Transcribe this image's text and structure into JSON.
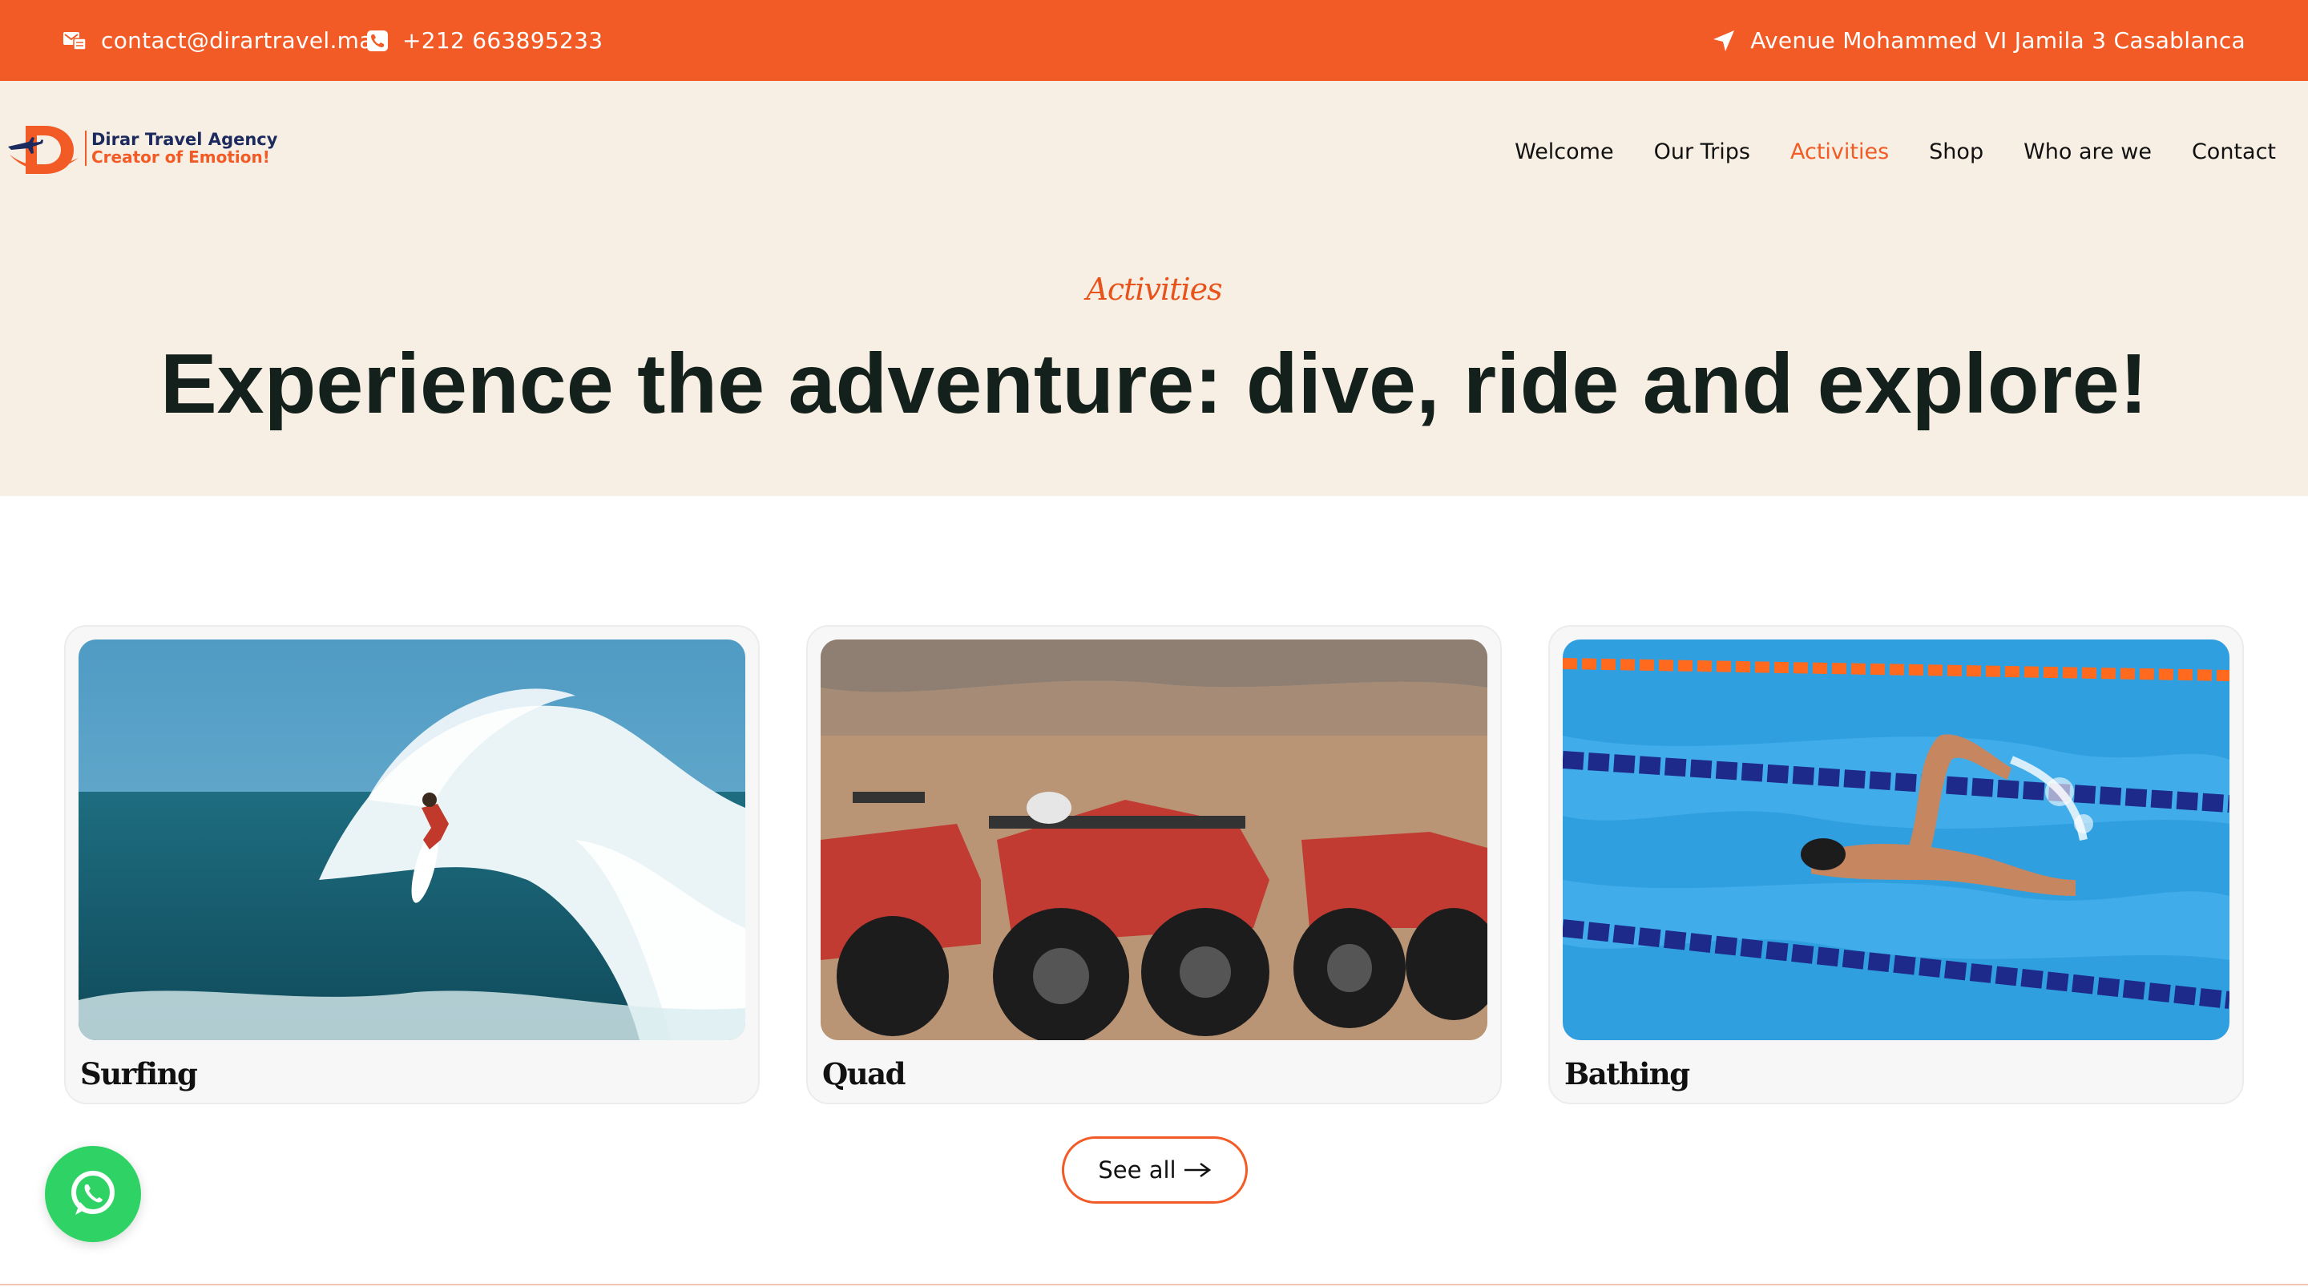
{
  "topbar": {
    "email": "contact@dirartravel.ma",
    "phone": "+212 663895233",
    "address": "Avenue Mohammed VI Jamila 3 Casablanca",
    "email_icon": "email-icon",
    "phone_icon": "phone-icon",
    "address_icon": "location-arrow-icon"
  },
  "brand": {
    "name": "Dirar Travel Agency",
    "tagline": "Creator of Emotion!",
    "colors": {
      "accent": "#f25b25",
      "navy": "#1c2a5e",
      "hero_bg": "#f7efe3"
    }
  },
  "nav": {
    "items": [
      {
        "label": "Welcome",
        "active": false
      },
      {
        "label": "Our Trips",
        "active": false
      },
      {
        "label": "Activities",
        "active": true
      },
      {
        "label": "Shop",
        "active": false
      },
      {
        "label": "Who are we",
        "active": false
      },
      {
        "label": "Contact",
        "active": false
      }
    ]
  },
  "hero": {
    "kicker": "Activities",
    "title": "Experience the adventure: dive, ride and explore!"
  },
  "cards": [
    {
      "title": "Surfing",
      "image": "surfer-riding-wave-photo"
    },
    {
      "title": "Quad",
      "image": "red-quad-bikes-desert-photo"
    },
    {
      "title": "Bathing",
      "image": "swimmer-in-pool-photo"
    }
  ],
  "see_all": {
    "label": "See all",
    "icon": "arrow-right-icon"
  },
  "whatsapp": {
    "icon": "whatsapp-icon"
  }
}
